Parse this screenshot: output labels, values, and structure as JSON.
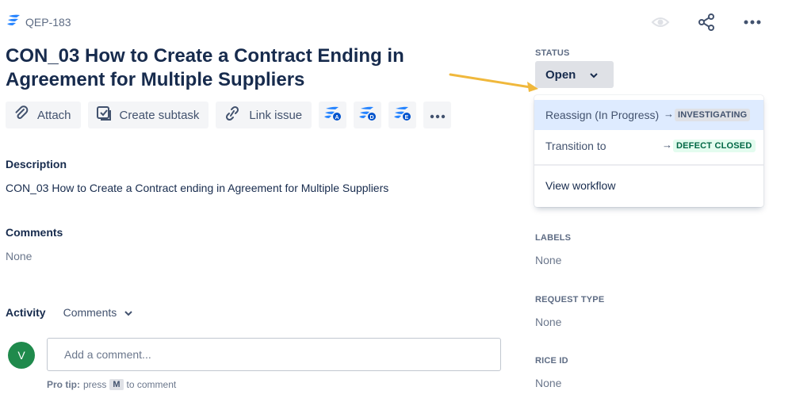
{
  "header": {
    "issue_key": "QEP-183",
    "title": "CON_03 How to Create a Contract Ending in Agreement for Multiple Suppliers",
    "icons": [
      "project-icon",
      "watch-icon",
      "share-icon",
      "more-icon"
    ]
  },
  "toolbar": {
    "attach_label": "Attach",
    "create_subtask_label": "Create subtask",
    "link_issue_label": "Link issue",
    "app_icons": [
      {
        "name": "app-a-icon",
        "letter": "A"
      },
      {
        "name": "app-d-icon",
        "letter": "D"
      },
      {
        "name": "app-e-icon",
        "letter": "E"
      }
    ]
  },
  "description": {
    "heading": "Description",
    "text": "CON_03 How to Create a Contract ending in Agreement for Multiple Suppliers"
  },
  "comments": {
    "heading": "Comments",
    "value": "None"
  },
  "activity": {
    "label": "Activity",
    "filter": "Comments",
    "avatar_initial": "V",
    "comment_placeholder": "Add a comment...",
    "protip_prefix": "Pro tip:",
    "protip_press": "press",
    "protip_key": "M",
    "protip_suffix": "to comment"
  },
  "sidebar": {
    "status_label": "STATUS",
    "status_value": "Open",
    "labels_label": "LABELS",
    "labels_value": "None",
    "request_type_label": "REQUEST TYPE",
    "request_type_value": "None",
    "rice_id_label": "RICE ID",
    "rice_id_value": "None"
  },
  "status_dropdown": {
    "items": [
      {
        "label": "Reassign (In Progress)",
        "target": "INVESTIGATING",
        "target_color": "#dfe1e6"
      },
      {
        "label": "Transition to",
        "target": "DEFECT CLOSED",
        "target_color": "#e3fcef"
      }
    ],
    "view_workflow": "View workflow"
  },
  "colors": {
    "accent": "#0052cc",
    "annotation_arrow": "#f0b83c",
    "avatar": "#1f8a4c"
  }
}
